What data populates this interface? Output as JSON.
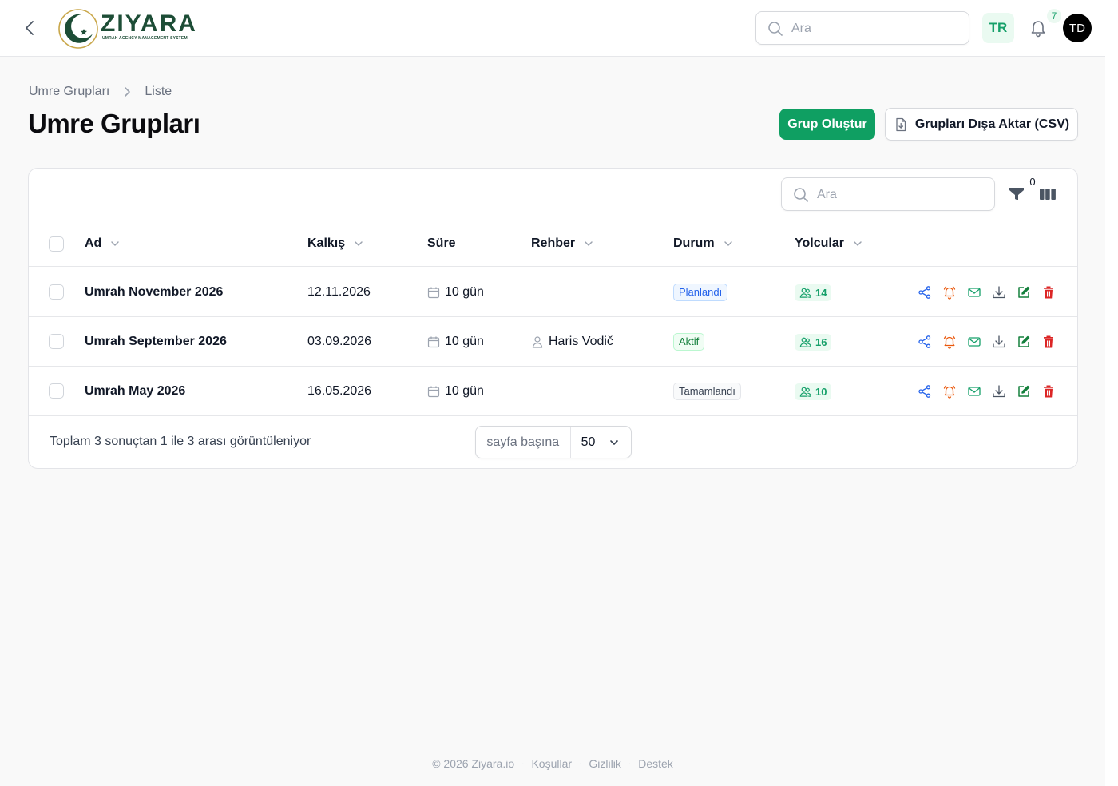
{
  "brand": {
    "name": "ZIYARA",
    "tagline": "UMRAH AGENCY MANAGEMENT SYSTEM"
  },
  "topbar": {
    "search_placeholder": "Ara",
    "language": "TR",
    "notification_count": "7",
    "avatar_initials": "TD"
  },
  "breadcrumb": {
    "parent": "Umre Grupları",
    "current": "Liste"
  },
  "page": {
    "title": "Umre Grupları",
    "create_button": "Grup Oluştur",
    "export_button": "Grupları Dışa Aktar (CSV)"
  },
  "table": {
    "search_placeholder": "Ara",
    "filter_count": "0",
    "columns": {
      "name": "Ad",
      "departure": "Kalkış",
      "duration": "Süre",
      "guide": "Rehber",
      "status": "Durum",
      "passengers": "Yolcular"
    },
    "rows": [
      {
        "name": "Umrah November 2026",
        "departure": "12.11.2026",
        "duration": "10 gün",
        "guide": "",
        "status": "Planlandı",
        "passengers": "14"
      },
      {
        "name": "Umrah September 2026",
        "departure": "03.09.2026",
        "duration": "10 gün",
        "guide": "Haris Vodič",
        "status": "Aktif",
        "passengers": "16"
      },
      {
        "name": "Umrah May 2026",
        "departure": "16.05.2026",
        "duration": "10 gün",
        "guide": "",
        "status": "Tamamlandı",
        "passengers": "10"
      }
    ],
    "status_colors": {
      "Planlandı": {
        "text": "#2563eb",
        "bg": "#eff6ff",
        "border": "#bfdbfe"
      },
      "Aktif": {
        "text": "#15803d",
        "bg": "#f0fdf4",
        "border": "#bbf7d0"
      },
      "Tamamlandı": {
        "text": "#374151",
        "bg": "#f9fafb",
        "border": "#e5e7eb"
      }
    },
    "row_actions": [
      "share-icon",
      "bell-icon",
      "mail-icon",
      "download-icon",
      "edit-icon",
      "trash-icon"
    ],
    "footer": {
      "summary": "Toplam 3 sonuçtan 1 ile 3 arası görüntüleniyor",
      "per_page_label": "sayfa başına",
      "per_page_value": "50"
    }
  },
  "footer": {
    "copyright": "© 2026 Ziyara.io",
    "links": [
      "Koşullar",
      "Gizlilik",
      "Destek"
    ]
  },
  "colors": {
    "primary": "#0f9f62",
    "brand_dark": "#1d4d36",
    "danger": "#dc2626",
    "link_blue": "#2563eb",
    "warning": "#ea580c"
  }
}
